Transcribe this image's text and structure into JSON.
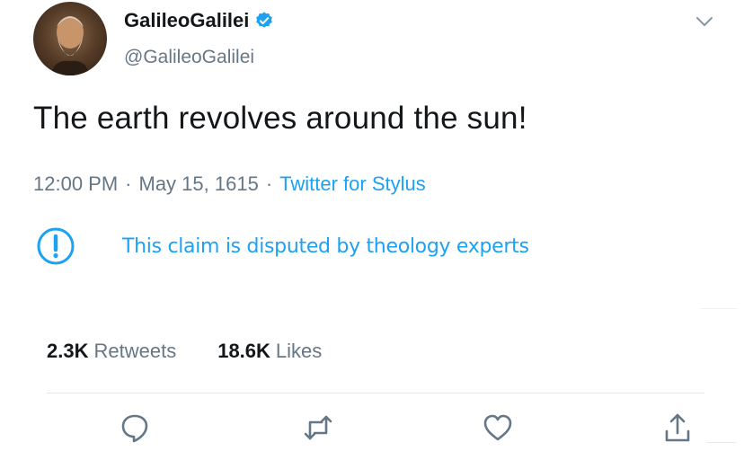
{
  "author": {
    "name": "GalileoGalilei",
    "handle": "@GalileoGalilei",
    "verified": true
  },
  "tweet": {
    "text": "The earth revolves around the sun!",
    "time": "12:00 PM",
    "date": "May 15, 1615",
    "source": "Twitter for Stylus",
    "separator": "·"
  },
  "notice": {
    "text": "This claim is disputed by theology experts",
    "icon": "exclamation-circle-icon"
  },
  "stats": {
    "retweets_count": "2.3K",
    "retweets_label": "Retweets",
    "likes_count": "18.6K",
    "likes_label": "Likes"
  },
  "icons": {
    "reply": "reply-icon",
    "retweet": "retweet-icon",
    "like": "heart-icon",
    "share": "share-icon",
    "menu": "chevron-down-icon"
  },
  "colors": {
    "accent": "#1da1f2",
    "text": "#14171a",
    "muted": "#657786"
  }
}
